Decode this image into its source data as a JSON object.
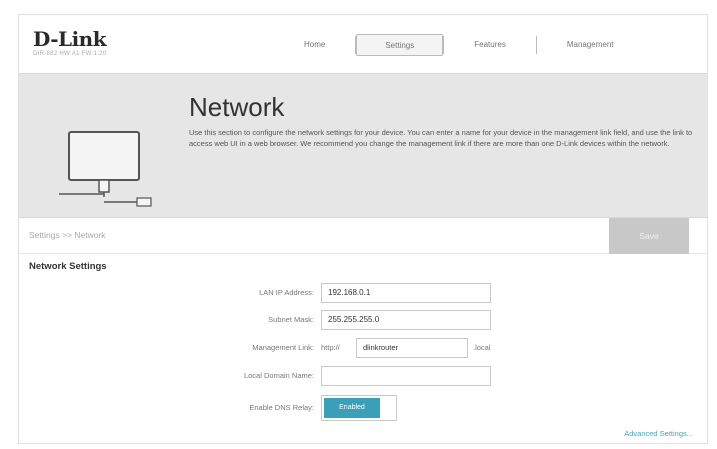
{
  "header": {
    "brand": "D-Link",
    "model": "DIR-882 HW:A1 FW:1.20"
  },
  "nav": {
    "items": [
      {
        "label": "Home"
      },
      {
        "label": "Settings"
      },
      {
        "label": "Features"
      },
      {
        "label": "Management"
      }
    ],
    "active": "Settings"
  },
  "banner": {
    "title": "Network",
    "description": "Use this section to configure the network settings for your device. You can enter a name for your device in the management link field, and use the link to access web UI in a web browser. We recommend you change the management link if there are more than one D-Link devices within the network.",
    "icon": "router-device-icon"
  },
  "breadcrumb": "Settings >> Network",
  "toolbar": {
    "save_label": "Save"
  },
  "section": {
    "title": "Network Settings",
    "fields": {
      "lan_ip": {
        "label": "LAN IP Address:",
        "value": "192.168.0.1"
      },
      "subnet": {
        "label": "Subnet Mask:",
        "value": "255.255.255.0"
      },
      "mgmt": {
        "label": "Management Link:",
        "prefix": "http://",
        "value": "dlinkrouter",
        "suffix": ".local"
      },
      "domain": {
        "label": "Local Domain Name:",
        "value": ""
      },
      "dns_relay": {
        "label": "Enable DNS Relay:",
        "state": "Enabled"
      }
    }
  },
  "advanced_link": "Advanced Settings...",
  "colors": {
    "accent": "#3aa0b8",
    "save_button": "#c8c8c8",
    "banner_bg": "#e6e6e6"
  }
}
